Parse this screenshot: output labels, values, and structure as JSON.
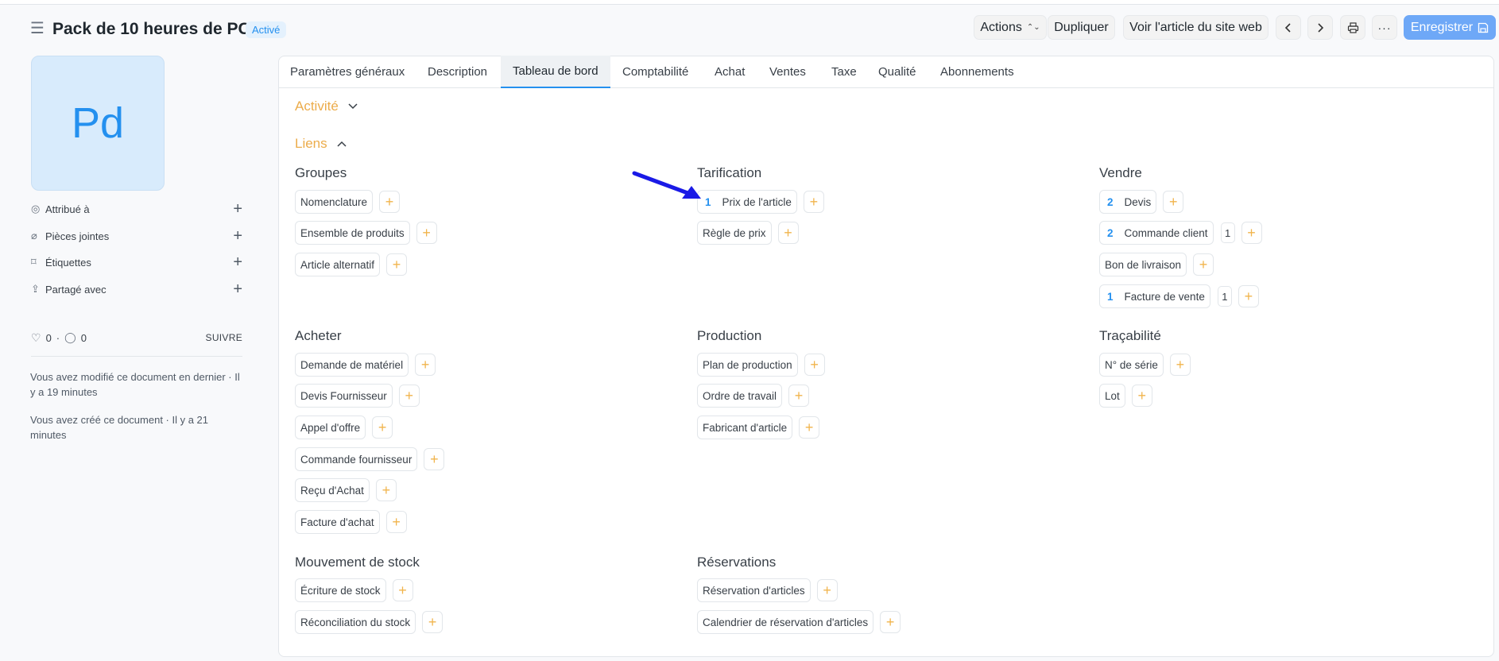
{
  "header": {
    "title": "Pack de 10 heures de PC",
    "status": "Activé",
    "actions_label": "Actions",
    "duplicate_label": "Dupliquer",
    "view_site_label": "Voir l'article du site web",
    "save_label": "Enregistrer"
  },
  "sidebar": {
    "avatar_initials": "Pd",
    "items": [
      {
        "label": "Attribué à"
      },
      {
        "label": "Pièces jointes"
      },
      {
        "label": "Étiquettes"
      },
      {
        "label": "Partagé avec"
      }
    ],
    "likes": "0",
    "comments": "0",
    "follow_label": "SUIVRE",
    "modified_text": "Vous avez modifié ce document en dernier · Il y a 19 minutes",
    "created_text": "Vous avez créé ce document · Il y a 21 minutes"
  },
  "tabs": [
    {
      "label": "Paramètres généraux"
    },
    {
      "label": "Description"
    },
    {
      "label": "Tableau de bord"
    },
    {
      "label": "Comptabilité"
    },
    {
      "label": "Achat"
    },
    {
      "label": "Ventes"
    },
    {
      "label": "Taxe"
    },
    {
      "label": "Qualité"
    },
    {
      "label": "Abonnements"
    }
  ],
  "sections": {
    "activity": "Activité",
    "links": "Liens"
  },
  "groups": {
    "groupes": {
      "title": "Groupes",
      "links": [
        {
          "label": "Nomenclature"
        },
        {
          "label": "Ensemble de produits"
        },
        {
          "label": "Article alternatif"
        }
      ]
    },
    "tarification": {
      "title": "Tarification",
      "links": [
        {
          "count": "1",
          "label": "Prix de l'article"
        },
        {
          "label": "Règle de prix"
        }
      ]
    },
    "vendre": {
      "title": "Vendre",
      "links": [
        {
          "count": "2",
          "label": "Devis"
        },
        {
          "count": "2",
          "label": "Commande client",
          "extra": "1"
        },
        {
          "label": "Bon de livraison"
        },
        {
          "count": "1",
          "label": "Facture de vente",
          "extra": "1"
        }
      ]
    },
    "acheter": {
      "title": "Acheter",
      "links": [
        {
          "label": "Demande de matériel"
        },
        {
          "label": "Devis Fournisseur"
        },
        {
          "label": "Appel d'offre"
        },
        {
          "label": "Commande fournisseur"
        },
        {
          "label": "Reçu d'Achat"
        },
        {
          "label": "Facture d'achat"
        }
      ]
    },
    "production": {
      "title": "Production",
      "links": [
        {
          "label": "Plan de production"
        },
        {
          "label": "Ordre de travail"
        },
        {
          "label": "Fabricant d'article"
        }
      ]
    },
    "tracabilite": {
      "title": "Traçabilité",
      "links": [
        {
          "label": "N° de série"
        },
        {
          "label": "Lot"
        }
      ]
    },
    "stock": {
      "title": "Mouvement de stock",
      "links": [
        {
          "label": "Écriture de stock"
        },
        {
          "label": "Réconciliation du stock"
        }
      ]
    },
    "reservations": {
      "title": "Réservations",
      "links": [
        {
          "label": "Réservation d'articles"
        },
        {
          "label": "Calendrier de réservation d'articles"
        }
      ]
    }
  },
  "annotation": {
    "color": "#1a1ae6"
  }
}
